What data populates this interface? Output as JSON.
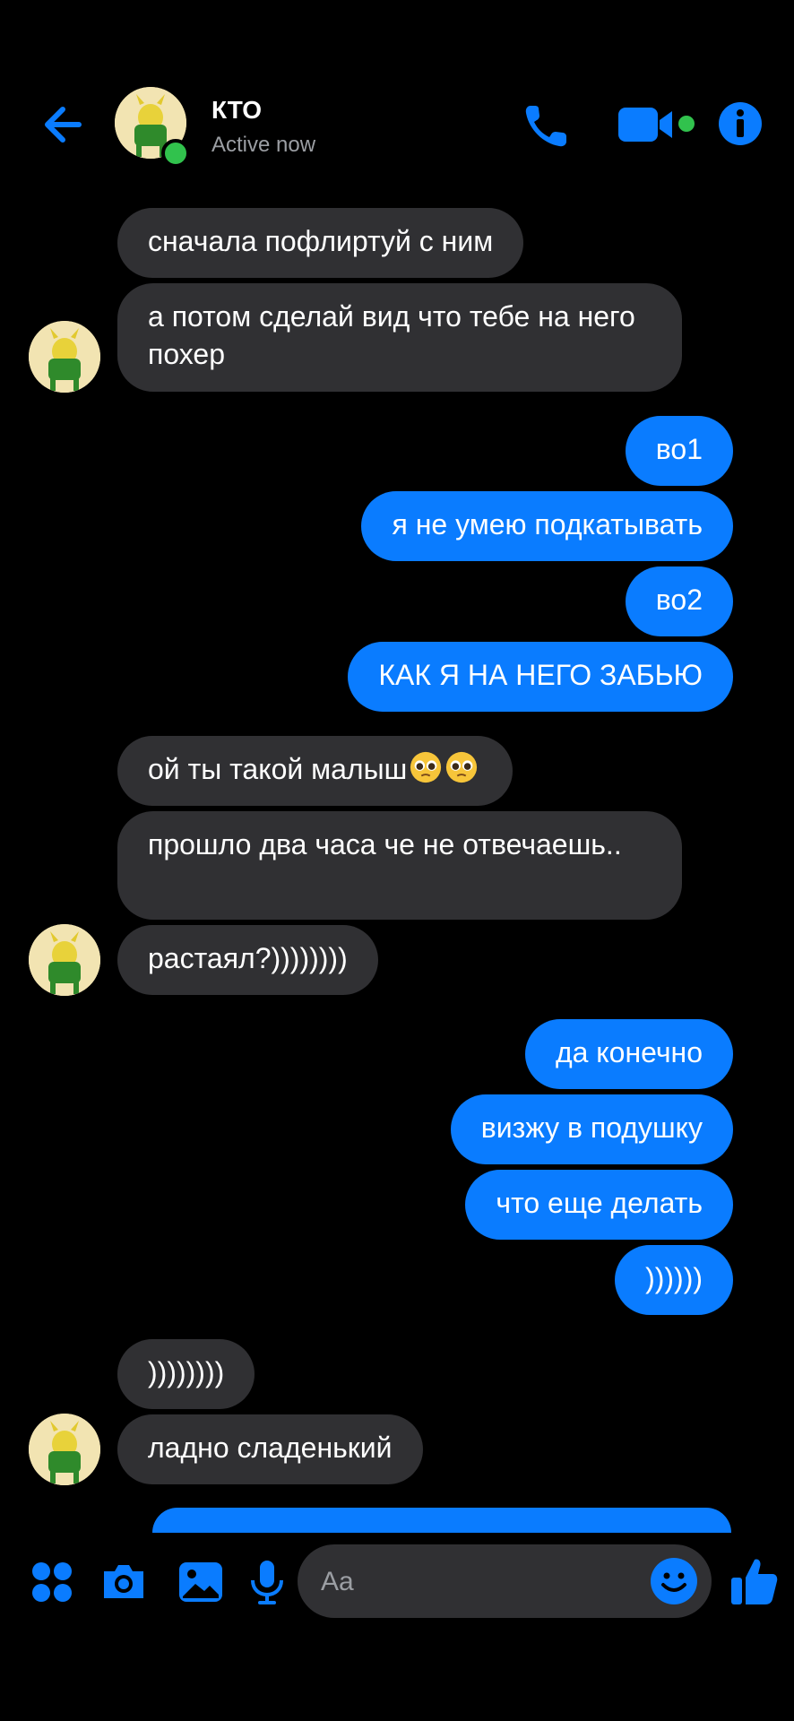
{
  "header": {
    "contact_name": "КТО",
    "status": "Active now",
    "accent": "#0a7cff",
    "online_color": "#31c24d"
  },
  "icons": {
    "back": "back-arrow-icon",
    "call": "phone-icon",
    "video": "video-camera-icon",
    "info": "info-icon",
    "apps": "apps-grid-icon",
    "camera": "camera-icon",
    "gallery": "image-icon",
    "mic": "microphone-icon",
    "emoji": "emoji-icon",
    "like": "thumbs-up-icon",
    "pleading": "pleading-face-emoji"
  },
  "messages": [
    {
      "from": "them",
      "text": "сначала пофлиртуй с ним"
    },
    {
      "from": "them",
      "text": "а потом сделай вид что тебе на него похер"
    },
    {
      "from": "me",
      "text": "во1"
    },
    {
      "from": "me",
      "text": "я не умею подкатывать"
    },
    {
      "from": "me",
      "text": "во2"
    },
    {
      "from": "me",
      "text": "КАК Я НА НЕГО ЗАБЬЮ"
    },
    {
      "from": "them",
      "text": "ой ты такой малыш"
    },
    {
      "from": "them",
      "text": "прошло два часа че не отвечаешь.."
    },
    {
      "from": "them",
      "text": "растаял?))))))))"
    },
    {
      "from": "me",
      "text": "да конечно"
    },
    {
      "from": "me",
      "text": "визжу в подушку"
    },
    {
      "from": "me",
      "text": "что еще делать"
    },
    {
      "from": "me",
      "text": "))))))"
    },
    {
      "from": "them",
      "text": "))))))))"
    },
    {
      "from": "them",
      "text": "ладно сладенький"
    }
  ],
  "colors": {
    "incoming_bubble": "#303033",
    "outgoing_bubble": "#0a7cff",
    "background": "#000000",
    "muted_text": "#9b9ea3"
  },
  "composer": {
    "placeholder": "Aa"
  }
}
